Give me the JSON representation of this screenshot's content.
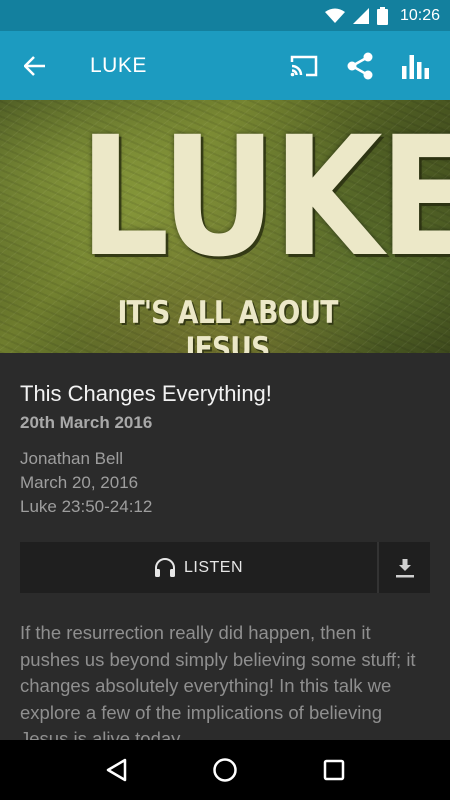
{
  "status_bar": {
    "time": "10:26"
  },
  "app_bar": {
    "title": "LUKE",
    "actions": [
      "cast-icon",
      "share-icon",
      "stats-icon"
    ]
  },
  "hero": {
    "headline": "LUKE",
    "subline": "IT'S ALL ABOUT JESUS"
  },
  "sermon": {
    "title": "This Changes Everything!",
    "date_heading": "20th March 2016",
    "speaker": "Jonathan Bell",
    "date": "March 20, 2016",
    "passage": "Luke 23:50-24:12",
    "listen_label": "LISTEN",
    "description": "If the resurrection really did happen, then it pushes us beyond simply believing some stuff; it changes absolutely everything! In this talk we explore a few of the implications of believing Jesus is alive today."
  },
  "colors": {
    "status_bar": "#13809e",
    "app_bar": "#1c9bc0",
    "background": "#2b2b2b"
  }
}
